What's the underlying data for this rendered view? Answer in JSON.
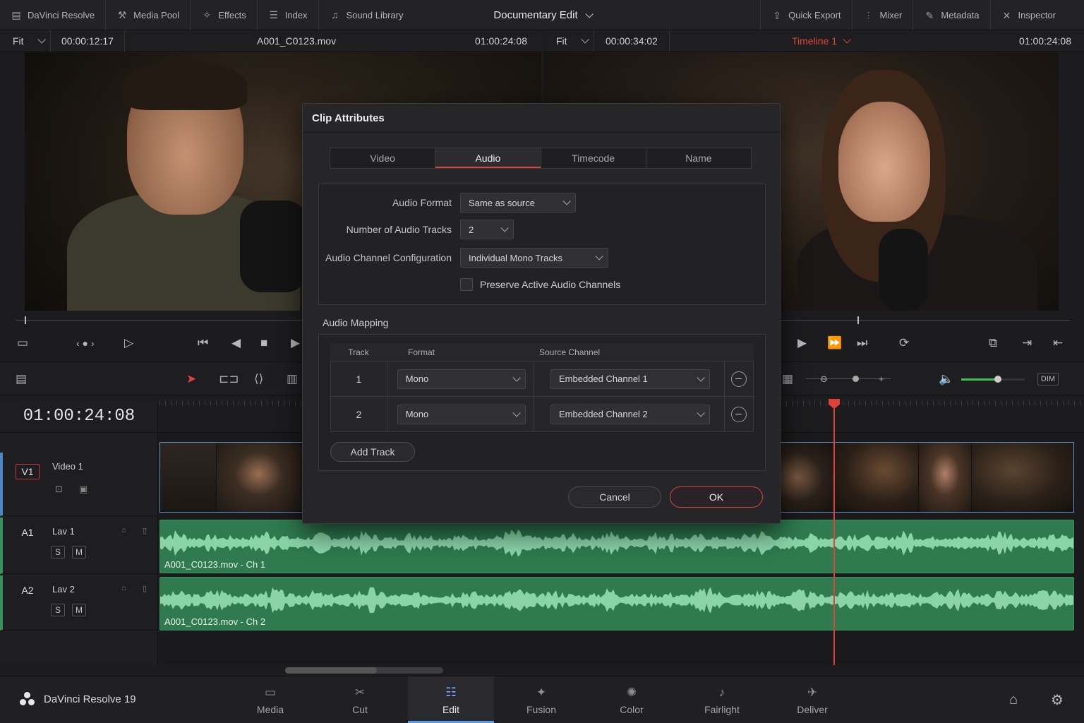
{
  "topbar": {
    "app": "DaVinci Resolve",
    "media_pool": "Media Pool",
    "effects": "Effects",
    "index": "Index",
    "sound_library": "Sound Library",
    "project_title": "Documentary Edit",
    "quick_export": "Quick Export",
    "mixer": "Mixer",
    "metadata": "Metadata",
    "inspector": "Inspector"
  },
  "source_viewer": {
    "fit": "Fit",
    "duration_tc": "00:00:12:17",
    "clip_name": "A001_C0123.mov",
    "current_tc": "01:00:24:08"
  },
  "timeline_viewer": {
    "fit": "Fit",
    "duration_tc": "00:00:34:02",
    "timeline_name": "Timeline 1",
    "current_tc": "01:00:24:08"
  },
  "timeline": {
    "timecode": "01:00:24:08",
    "tracks": {
      "v1": {
        "id": "V1",
        "name": "Video 1"
      },
      "a1": {
        "id": "A1",
        "name": "Lav 1",
        "solo": "S",
        "mute": "M",
        "clip_label": "A001_C0123.mov - Ch 1"
      },
      "a2": {
        "id": "A2",
        "name": "Lav 2",
        "solo": "S",
        "mute": "M",
        "clip_label": "A001_C0123.mov - Ch 2"
      }
    },
    "dim_label": "DIM"
  },
  "dialog": {
    "title": "Clip Attributes",
    "tabs": [
      "Video",
      "Audio",
      "Timecode",
      "Name"
    ],
    "active_tab": "Audio",
    "audio_format_label": "Audio Format",
    "audio_format_value": "Same as source",
    "num_tracks_label": "Number of Audio Tracks",
    "num_tracks_value": "2",
    "channel_config_label": "Audio Channel Configuration",
    "channel_config_value": "Individual Mono Tracks",
    "preserve_label": "Preserve Active Audio Channels",
    "preserve_checked": false,
    "mapping_title": "Audio Mapping",
    "mapping_headers": {
      "track": "Track",
      "format": "Format",
      "source": "Source Channel"
    },
    "mapping_rows": [
      {
        "track": "1",
        "format": "Mono",
        "source": "Embedded Channel 1"
      },
      {
        "track": "2",
        "format": "Mono",
        "source": "Embedded Channel 2"
      }
    ],
    "add_track": "Add Track",
    "cancel": "Cancel",
    "ok": "OK"
  },
  "pagebar": {
    "brand": "DaVinci Resolve 19",
    "pages": [
      "Media",
      "Cut",
      "Edit",
      "Fusion",
      "Color",
      "Fairlight",
      "Deliver"
    ],
    "active_page": "Edit"
  },
  "colors": {
    "accent_red": "#d6453c",
    "accent_blue": "#5b9be8",
    "audio_clip": "#2f7a4f",
    "playhead": "#e0403a"
  }
}
